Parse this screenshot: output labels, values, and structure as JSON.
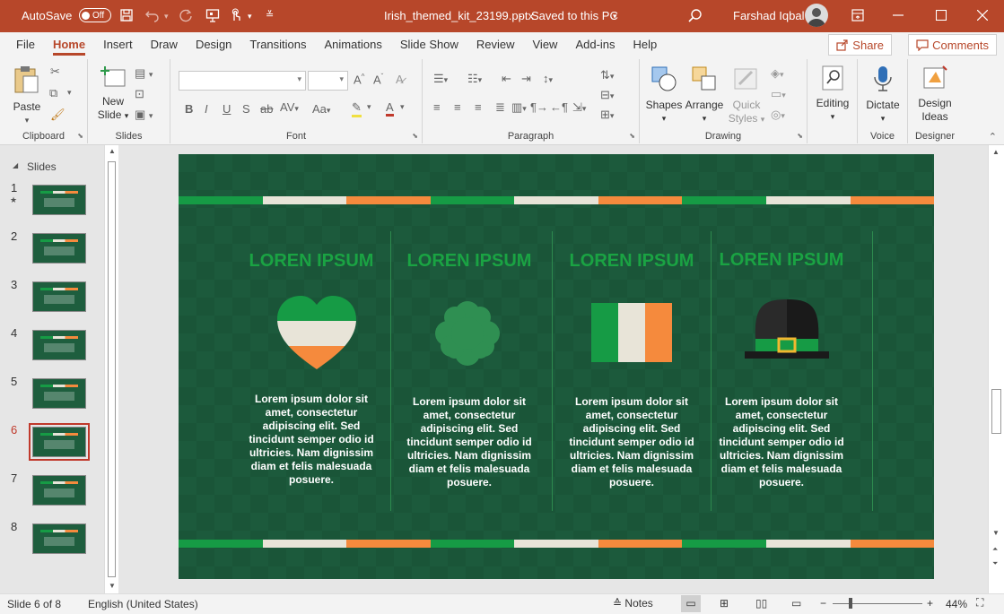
{
  "titlebar": {
    "autosave_label": "AutoSave",
    "autosave_state": "Off",
    "filename": "Irish_themed_kit_23199.pptx",
    "save_status": "Saved to this PC",
    "user_name": "Farshad Iqbal"
  },
  "tabs": [
    "File",
    "Home",
    "Insert",
    "Draw",
    "Design",
    "Transitions",
    "Animations",
    "Slide Show",
    "Review",
    "View",
    "Add-ins",
    "Help"
  ],
  "active_tab": "Home",
  "share_label": "Share",
  "comments_label": "Comments",
  "ribbon": {
    "clipboard": {
      "paste": "Paste",
      "group": "Clipboard"
    },
    "slides": {
      "new_slide_line1": "New",
      "new_slide_line2": "Slide",
      "group": "Slides"
    },
    "font": {
      "group": "Font"
    },
    "paragraph": {
      "group": "Paragraph"
    },
    "drawing": {
      "shapes": "Shapes",
      "arrange": "Arrange",
      "quick_styles_line1": "Quick",
      "quick_styles_line2": "Styles",
      "group": "Drawing"
    },
    "editing": {
      "label": "Editing"
    },
    "voice": {
      "dictate": "Dictate",
      "group": "Voice"
    },
    "designer": {
      "design_ideas_line1": "Design",
      "design_ideas_line2": "Ideas",
      "group": "Designer"
    }
  },
  "panel": {
    "title": "Slides",
    "thumbnails": [
      "1",
      "2",
      "3",
      "4",
      "5",
      "6",
      "7",
      "8"
    ],
    "selected": "6"
  },
  "slide": {
    "columns": [
      {
        "title": "LOREN IPSUM",
        "icon": "heart-flag-icon",
        "text": "Lorem ipsum dolor sit amet, consectetur adipiscing elit. Sed tincidunt semper odio id ultricies. Nam dignissim diam et felis malesuada posuere."
      },
      {
        "title": "LOREN IPSUM",
        "icon": "shamrock-icon",
        "text": "Lorem ipsum dolor sit amet, consectetur adipiscing elit. Sed tincidunt semper odio id ultricies. Nam dignissim diam et felis malesuada posuere."
      },
      {
        "title": "LOREN IPSUM",
        "icon": "irish-flag-icon",
        "text": "Lorem ipsum dolor sit amet, consectetur adipiscing elit. Sed tincidunt semper odio id ultricies. Nam dignissim diam et felis malesuada posuere."
      },
      {
        "title": "LOREN IPSUM",
        "icon": "leprechaun-hat-icon",
        "text": "Lorem ipsum dolor sit amet, consectetur adipiscing elit. Sed tincidunt semper odio id ultricies. Nam dignissim diam et felis malesuada posuere."
      }
    ]
  },
  "statusbar": {
    "slide_info": "Slide 6 of 8",
    "language": "English (United States)",
    "notes": "Notes",
    "zoom": "44%"
  },
  "colors": {
    "brand": "#b7472a",
    "irish_green": "#169b45",
    "irish_white": "#e8e4d8",
    "irish_orange": "#f58a3d",
    "slide_bg": "#1c5a3c"
  }
}
